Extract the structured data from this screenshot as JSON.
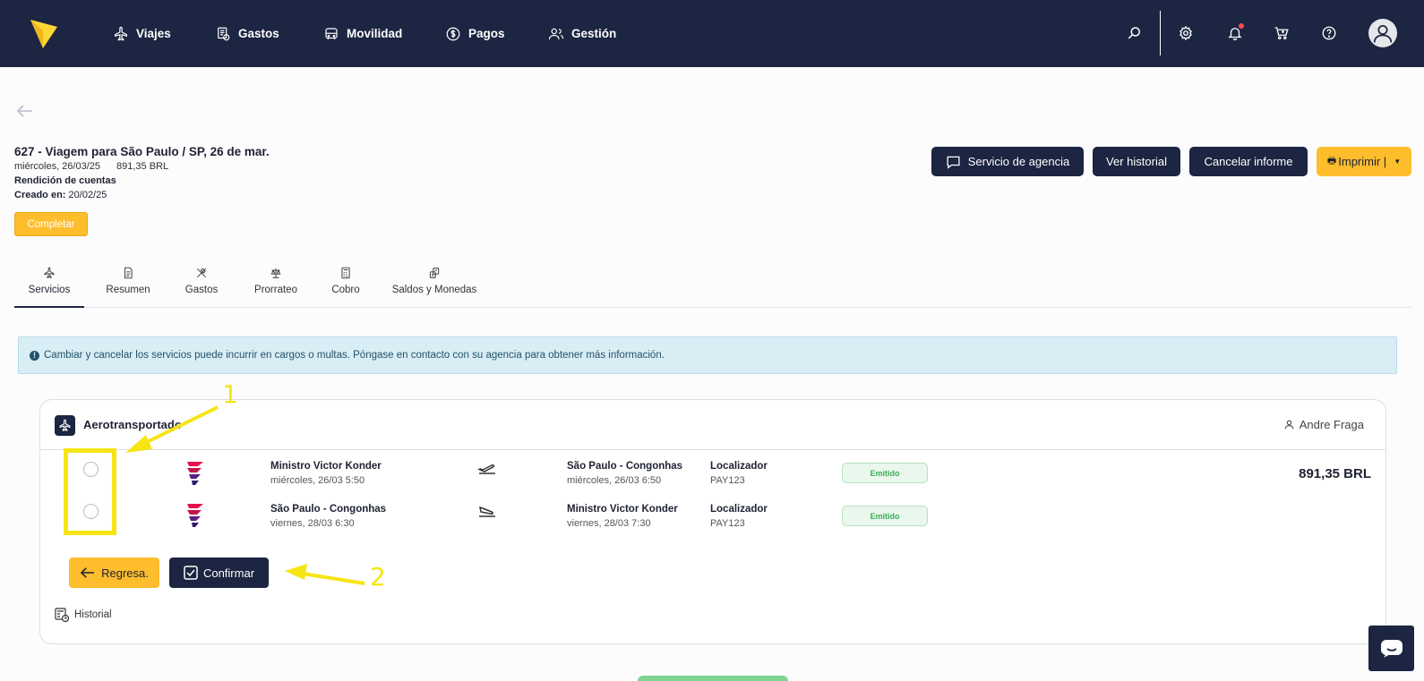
{
  "nav": {
    "items": [
      {
        "label": "Viajes",
        "icon": "plane-icon"
      },
      {
        "label": "Gastos",
        "icon": "receipt-icon"
      },
      {
        "label": "Movilidad",
        "icon": "car-icon"
      },
      {
        "label": "Pagos",
        "icon": "dollar-icon"
      },
      {
        "label": "Gestión",
        "icon": "users-icon"
      }
    ],
    "tools": [
      "search-icon",
      "gear-icon",
      "bell-icon",
      "cart-icon",
      "help-icon"
    ]
  },
  "report": {
    "title": "627 - Viagem para São Paulo / SP, 26 de mar.",
    "date": "miércoles, 26/03/25",
    "amount": "891,35 BRL",
    "type": "Rendición de cuentas",
    "created_label": "Creado en:",
    "created_value": "20/02/25",
    "status_label": "Completar"
  },
  "header_buttons": {
    "agency": "Servicio de agencia",
    "history": "Ver historial",
    "cancel": "Cancelar informe",
    "print": "Imprimir |"
  },
  "tabs": [
    {
      "label": "Servicios",
      "icon": "plane-icon",
      "active": true
    },
    {
      "label": "Resumen",
      "icon": "document-icon"
    },
    {
      "label": "Gastos",
      "icon": "cutlery-icon"
    },
    {
      "label": "Prorrateo",
      "icon": "scale-icon"
    },
    {
      "label": "Cobro",
      "icon": "calculator-icon"
    },
    {
      "label": "Saldos y Monedas",
      "icon": "coins-icon"
    }
  ],
  "alert": {
    "text": "Cambiar y cancelar los servicios puede incurrir en cargos o multas. Póngase en contacto con su agencia para obtener más información."
  },
  "service": {
    "title": "Aerotransportado",
    "traveler": "Andre Fraga",
    "price": "891,35 BRL",
    "legs": [
      {
        "origin": "Ministro Victor Konder",
        "origin_time": "miércoles, 26/03 5:50",
        "destination": "São Paulo - Congonhas",
        "destination_time": "miércoles, 26/03 6:50",
        "locator_label": "Localizador",
        "locator": "PAY123",
        "status": "Emitido"
      },
      {
        "origin": "São Paulo - Congonhas",
        "origin_time": "viernes, 28/03 6:30",
        "destination": "Ministro Victor Konder",
        "destination_time": "viernes, 28/03 7:30",
        "locator_label": "Localizador",
        "locator": "PAY123",
        "status": "Emitido"
      }
    ],
    "back_button": "Regresa.",
    "confirm_button": "Confirmar",
    "history_link": "Historial"
  },
  "annotations": {
    "label_1": "1",
    "label_2": "2"
  },
  "colors": {
    "navy": "#1c2541",
    "accent_yellow": "#fdbd2d",
    "annotation_yellow": "#f7e413",
    "emitted_green": "#3fae5a"
  }
}
